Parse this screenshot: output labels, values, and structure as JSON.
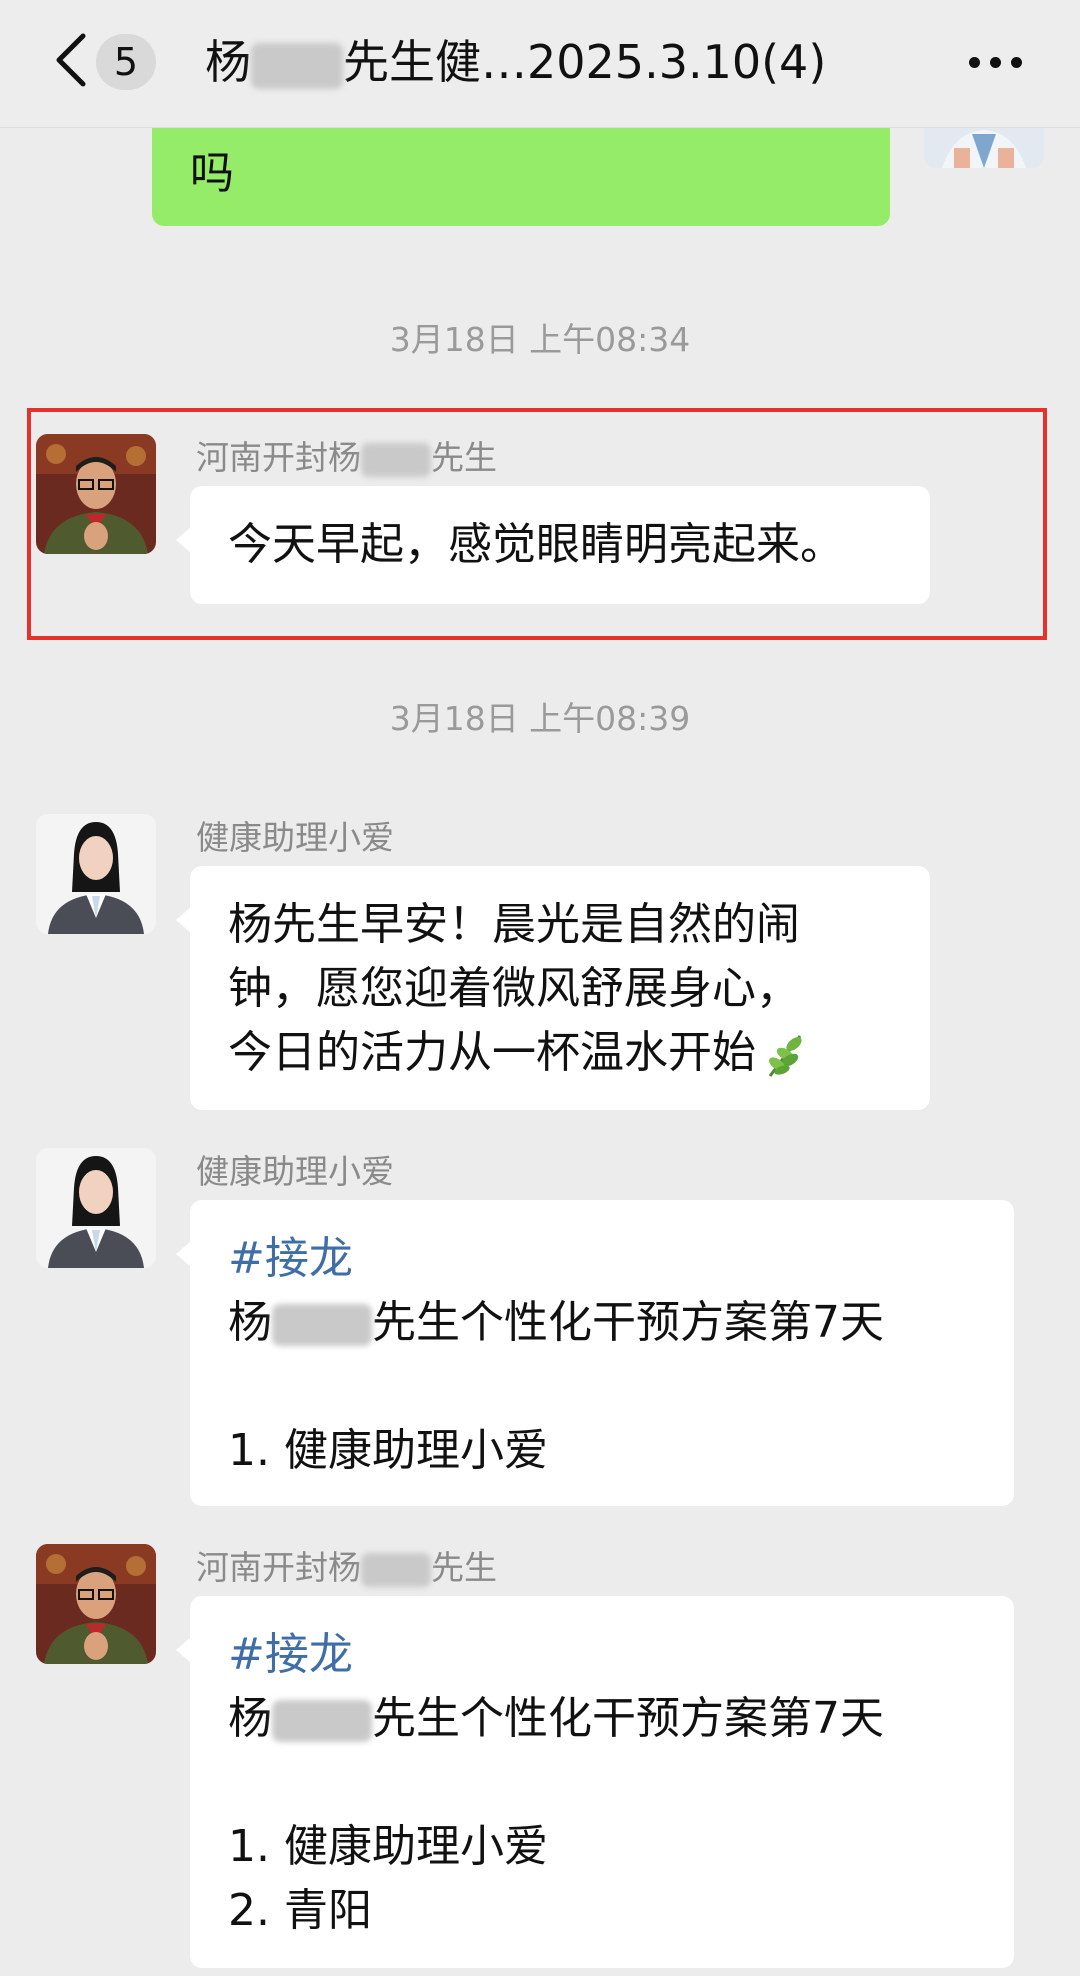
{
  "header": {
    "title_prefix": "杨",
    "title_suffix": "先生健…2025.3.10(4)",
    "unread_count": "5",
    "back_icon": "chevron-left-icon",
    "more_icon": "ellipsis-icon"
  },
  "messages": {
    "outgoing_top": {
      "text": "吗"
    },
    "ts1": "3月18日 上午08:34",
    "msg1": {
      "sender_prefix": "河南开封杨",
      "sender_suffix": "先生",
      "text": "今天早起，感觉眼睛明亮起来。"
    },
    "ts2": "3月18日 上午08:39",
    "msg2": {
      "sender": "健康助理小爱",
      "line1": "杨先生早安！晨光是自然的闹",
      "line2": "钟，愿您迎着微风舒展身心，",
      "line3": "今日的活力从一杯温水开始"
    },
    "msg3": {
      "sender": "健康助理小爱",
      "tag": "#接龙",
      "title_prefix": "杨",
      "title_suffix": "先生个性化干预方案第7天",
      "item1": "1. 健康助理小爱"
    },
    "msg4": {
      "sender_prefix": "河南开封杨",
      "sender_suffix": "先生",
      "tag": "#接龙",
      "title_prefix": "杨",
      "title_suffix": "先生个性化干预方案第7天",
      "item1": "1. 健康助理小爱",
      "item2": "2. 青阳"
    }
  },
  "colors": {
    "outgoing_bubble": "#95ec69",
    "highlight_border": "#e5322d",
    "hashtag": "#3f6ea6"
  }
}
